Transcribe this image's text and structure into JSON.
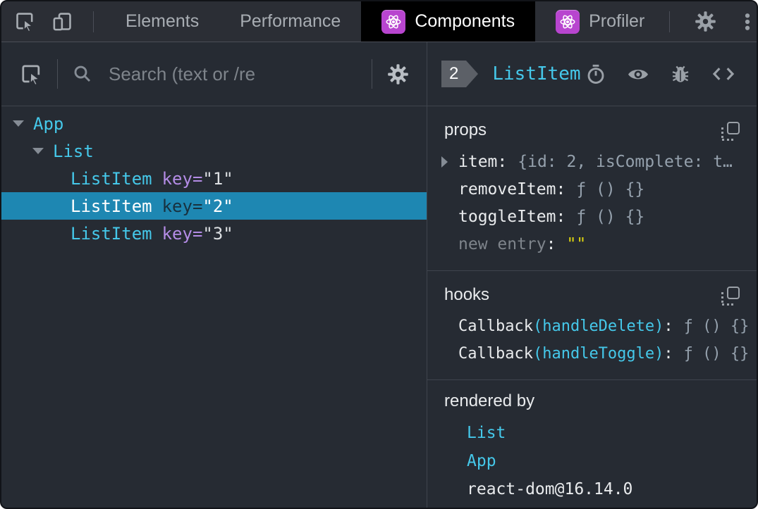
{
  "colors": {
    "accent_cyan": "#45c8ea",
    "attr_purple": "#b48ce6",
    "selection_blue": "#1e87b2",
    "react_purple": "#b845cf",
    "editable_yellow": "#dfd50f",
    "panel_bg": "#262b33",
    "toolbar_bg": "#2b2e35",
    "active_tab_bg": "#000000"
  },
  "topbar": {
    "tabs": [
      {
        "label": "Elements"
      },
      {
        "label": "Performance"
      },
      {
        "label": "Components"
      },
      {
        "label": "Profiler"
      }
    ]
  },
  "left_panel": {
    "search_placeholder": "Search (text or /re",
    "tree": [
      {
        "name": "App"
      },
      {
        "name": "List"
      },
      {
        "name": "ListItem",
        "attr": "key=",
        "value": "\"1\""
      },
      {
        "name": "ListItem",
        "attr": "key=",
        "value": "\"2\""
      },
      {
        "name": "ListItem",
        "attr": "key=",
        "value": "\"3\""
      }
    ]
  },
  "right_panel": {
    "badge": "2",
    "title": "ListItem",
    "props": {
      "title": "props",
      "rows": [
        {
          "name": "item",
          "sep": ":",
          "value": "{id: 2, isComplete: t…"
        },
        {
          "name": "removeItem",
          "sep": ":",
          "value": "ƒ () {}"
        },
        {
          "name": "toggleItem",
          "sep": ":",
          "value": "ƒ () {}"
        },
        {
          "name": "new entry",
          "sep": ":",
          "value": "\"\""
        }
      ]
    },
    "hooks": {
      "title": "hooks",
      "rows": [
        {
          "name": "Callback",
          "arg": "(handleDelete)",
          "sep": ":",
          "value": "ƒ () {}"
        },
        {
          "name": "Callback",
          "arg": "(handleToggle)",
          "sep": ":",
          "value": "ƒ () {}"
        }
      ]
    },
    "rendered_by": {
      "title": "rendered by",
      "items": [
        {
          "label": "List"
        },
        {
          "label": "App"
        },
        {
          "label": "react-dom@16.14.0"
        }
      ]
    }
  }
}
